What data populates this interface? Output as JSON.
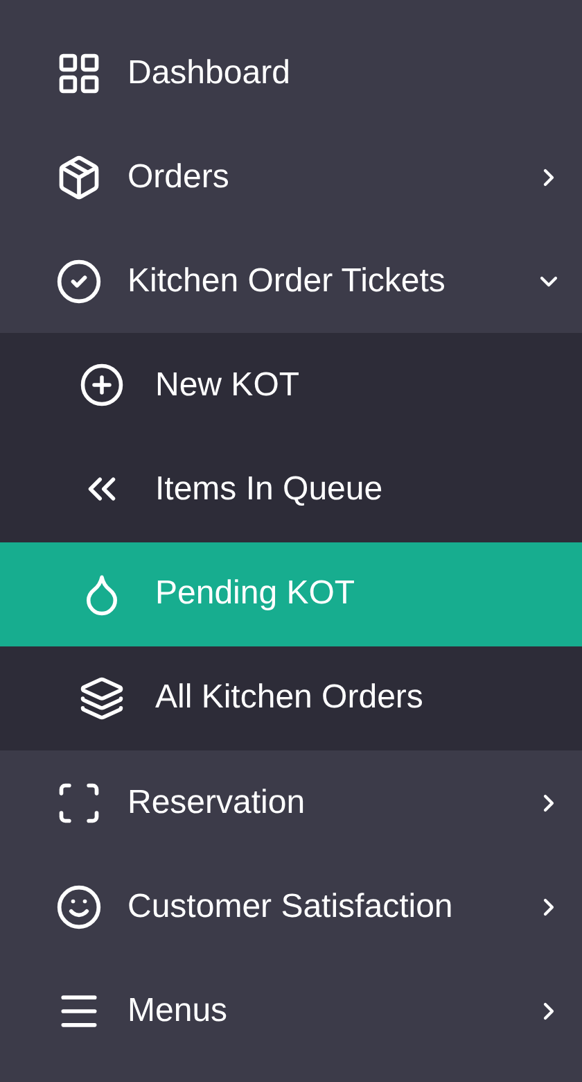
{
  "sidebar": {
    "items": [
      {
        "label": "Dashboard"
      },
      {
        "label": "Orders",
        "expanded": false
      },
      {
        "label": "Kitchen Order Tickets",
        "expanded": true,
        "children": [
          {
            "label": "New KOT",
            "selected": false
          },
          {
            "label": "Items In Queue",
            "selected": false
          },
          {
            "label": "Pending KOT",
            "selected": true
          },
          {
            "label": "All Kitchen Orders",
            "selected": false
          }
        ]
      },
      {
        "label": "Reservation",
        "expanded": false
      },
      {
        "label": "Customer Satisfaction",
        "expanded": false
      },
      {
        "label": "Menus",
        "expanded": false
      }
    ]
  }
}
